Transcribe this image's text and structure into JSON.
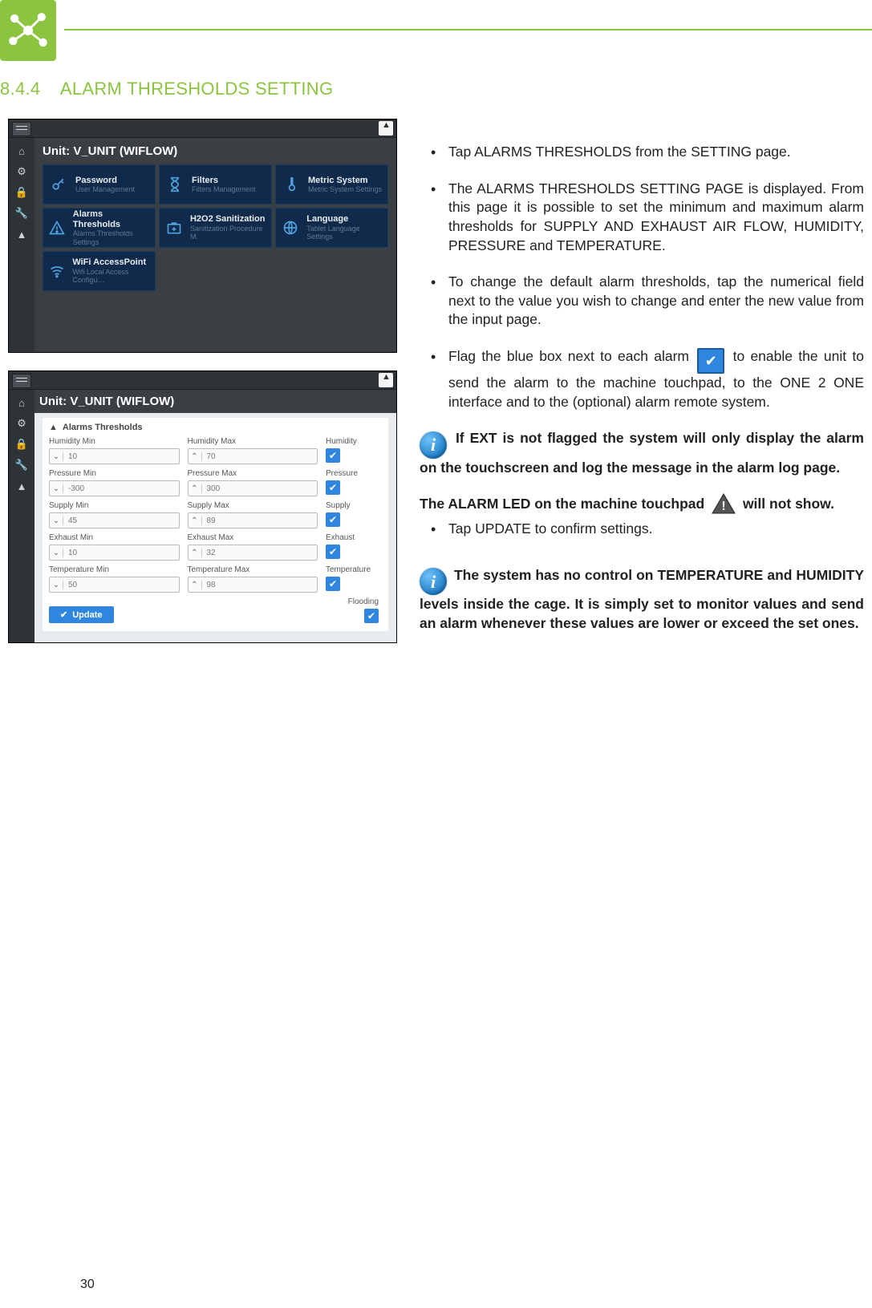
{
  "section": {
    "number": "8.4.4",
    "title": "ALARM THRESHOLDS SETTING"
  },
  "pageNumber": "30",
  "screenshot1": {
    "unitTitle": "Unit: V_UNIT (WIFLOW)",
    "tiles": [
      {
        "label": "Password",
        "sub": "User Management",
        "icon": "key"
      },
      {
        "label": "Filters",
        "sub": "Filters Management",
        "icon": "hourglass"
      },
      {
        "label": "Metric System",
        "sub": "Metric System Settings",
        "icon": "thermo"
      },
      {
        "label": "Alarms Thresholds",
        "sub": "Alarms Thresholds Settings",
        "icon": "warn"
      },
      {
        "label": "H2O2 Sanitization",
        "sub": "Sanitization Procedure M.",
        "icon": "medkit"
      },
      {
        "label": "Language",
        "sub": "Tablet Language Settings",
        "icon": "globe"
      },
      {
        "label": "WiFi AccessPoint",
        "sub": "Wifi Local Access Configu…",
        "icon": "wifi"
      }
    ]
  },
  "screenshot2": {
    "unitTitle": "Unit: V_UNIT (WIFLOW)",
    "cardTitle": "Alarms Thresholds",
    "rows": [
      {
        "minLabel": "Humidity Min",
        "minVal": "10",
        "maxLabel": "Humidity Max",
        "maxVal": "70",
        "ckLabel": "Humidity"
      },
      {
        "minLabel": "Pressure Min",
        "minVal": "-300",
        "maxLabel": "Pressure Max",
        "maxVal": "300",
        "ckLabel": "Pressure"
      },
      {
        "minLabel": "Supply Min",
        "minVal": "45",
        "maxLabel": "Supply Max",
        "maxVal": "89",
        "ckLabel": "Supply"
      },
      {
        "minLabel": "Exhaust Min",
        "minVal": "10",
        "maxLabel": "Exhaust Max",
        "maxVal": "32",
        "ckLabel": "Exhaust"
      },
      {
        "minLabel": "Temperature Min",
        "minVal": "50",
        "maxLabel": "Temperature Max",
        "maxVal": "98",
        "ckLabel": "Temperature"
      }
    ],
    "floodingLabel": "Flooding",
    "updateLabel": "Update"
  },
  "instructions": {
    "b1": "Tap ALARMS THRESHOLDS from the SETTING page.",
    "b2": "The ALARMS THRESHOLDS SETTING PAGE is displayed. From this page it is possible to set the minimum and maximum alarm thresholds for SUPPLY AND EXHAUST AIR FLOW, HUMIDITY, PRESSURE and TEMPERATURE.",
    "b3": "To change the default alarm thresholds, tap the numerical field next to the value you wish to change and enter the new value from the input page.",
    "b4a": "Flag the blue box next to each alarm ",
    "b4b": " to enable the unit to send the alarm to the machine touchpad, to the ONE 2 ONE interface and to the (optional) alarm remote system.",
    "info1": "If EXT is not flagged the system will only display the alarm on the touchscreen and log the message in the alarm log page.",
    "ledLine_a": "The ALARM LED on the machine touchpad ",
    "ledLine_b": " will not show.",
    "b5": "Tap UPDATE to confirm settings.",
    "info2": "The system has no control on TEMPERATURE and HUMIDITY levels inside the cage. It is simply set to monitor values and send an alarm whenever these values are lower or exceed the set ones."
  }
}
